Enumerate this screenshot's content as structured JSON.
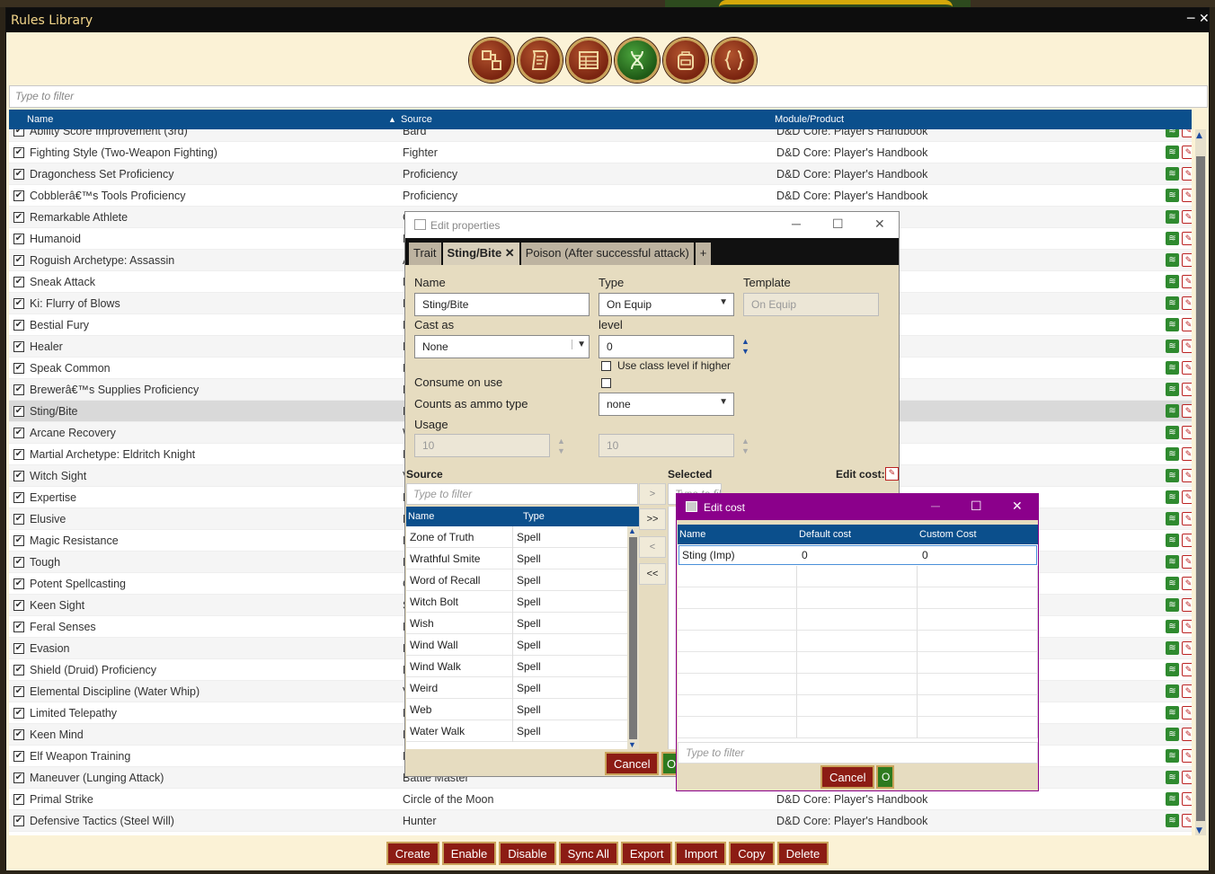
{
  "window": {
    "title": "Rules Library",
    "min_glyph": "─",
    "close_glyph": "✕"
  },
  "toolbar": {
    "icons": [
      "rules-icon",
      "scroll-icon",
      "table-icon",
      "dna-icon",
      "backpack-icon",
      "braces-icon"
    ]
  },
  "filter": {
    "placeholder": "Type to filter"
  },
  "table": {
    "headers": {
      "name": "Name",
      "source": "Source",
      "module": "Module/Product"
    },
    "rows": [
      {
        "name": "Ability Score Improvement (3rd)",
        "source": "Bard",
        "module": "D&D Core: Player's Handbook"
      },
      {
        "name": "Fighting Style (Two-Weapon Fighting)",
        "source": "Fighter",
        "module": "D&D Core: Player's Handbook"
      },
      {
        "name": "Dragonchess Set Proficiency",
        "source": "Proficiency",
        "module": "D&D Core: Player's Handbook"
      },
      {
        "name": "Cobblerâ€™s Tools Proficiency",
        "source": "Proficiency",
        "module": "D&D Core: Player's Handbook"
      },
      {
        "name": "Remarkable Athlete",
        "source": "C",
        "module": "ook"
      },
      {
        "name": "Humanoid",
        "source": "D",
        "module": "ook"
      },
      {
        "name": "Roguish Archetype: Assassin",
        "source": "A",
        "module": "ook"
      },
      {
        "name": "Sneak Attack",
        "source": "R",
        "module": "ook"
      },
      {
        "name": "Ki: Flurry of Blows",
        "source": "M",
        "module": "ook"
      },
      {
        "name": "Bestial Fury",
        "source": "B",
        "module": "ook"
      },
      {
        "name": "Healer",
        "source": "F",
        "module": "ook"
      },
      {
        "name": "Speak Common",
        "source": "H",
        "module": "ook"
      },
      {
        "name": "Brewerâ€™s Supplies Proficiency",
        "source": "P",
        "module": "ook"
      },
      {
        "name": "Sting/Bite",
        "source": "D",
        "module": "al"
      },
      {
        "name": "Arcane Recovery",
        "source": "W",
        "module": "ook"
      },
      {
        "name": "Martial Archetype: Eldritch Knight",
        "source": "E",
        "module": "ook"
      },
      {
        "name": "Witch Sight",
        "source": "V",
        "module": "ook"
      },
      {
        "name": "Expertise",
        "source": "E",
        "module": ""
      },
      {
        "name": "Elusive",
        "source": "E",
        "module": ""
      },
      {
        "name": "Magic Resistance",
        "source": "D",
        "module": ""
      },
      {
        "name": "Tough",
        "source": "F",
        "module": ""
      },
      {
        "name": "Potent Spellcasting",
        "source": "C",
        "module": ""
      },
      {
        "name": "Keen Sight",
        "source": "S",
        "module": ""
      },
      {
        "name": "Feral Senses",
        "source": "F",
        "module": ""
      },
      {
        "name": "Evasion",
        "source": "E",
        "module": ""
      },
      {
        "name": "Shield (Druid) Proficiency",
        "source": "D",
        "module": ""
      },
      {
        "name": "Elemental Discipline (Water Whip)",
        "source": "V",
        "module": ""
      },
      {
        "name": "Limited Telepathy",
        "source": "F",
        "module": ""
      },
      {
        "name": "Keen Mind",
        "source": "F",
        "module": ""
      },
      {
        "name": "Elf Weapon Training",
        "source": "H",
        "module": ""
      },
      {
        "name": "Maneuver (Lunging Attack)",
        "source": "Battle Master",
        "module": ""
      },
      {
        "name": "Primal Strike",
        "source": "Circle of the Moon",
        "module": "D&D Core: Player's Handbook"
      },
      {
        "name": "Defensive Tactics (Steel Will)",
        "source": "Hunter",
        "module": "D&D Core: Player's Handbook"
      }
    ]
  },
  "buttons": {
    "create": "Create",
    "enable": "Enable",
    "disable": "Disable",
    "sync_all": "Sync All",
    "export": "Export",
    "import": "Import",
    "copy": "Copy",
    "delete": "Delete"
  },
  "edit": {
    "title": "Edit properties",
    "tabs": [
      "Trait",
      "Sting/Bite ✕",
      "Poison (After successful attack)",
      "+"
    ],
    "name_label": "Name",
    "name_value": "Sting/Bite",
    "type_label": "Type",
    "type_value": "On Equip",
    "template_label": "Template",
    "template_value": "On Equip",
    "cast_label": "Cast as",
    "cast_value": "None",
    "level_label": "level",
    "level_value": "0",
    "use_class_level": "Use class level if higher",
    "consume_label": "Consume on use",
    "ammo_label": "Counts as ammo type",
    "ammo_value": "none",
    "usage_label": "Usage",
    "usage1": "10",
    "usage2": "10",
    "source_label": "Source",
    "selected_label": "Selected",
    "edit_cost_label": "Edit cost:",
    "filter_placeholder": "Type to filter",
    "list_headers": {
      "name": "Name",
      "type": "Type"
    },
    "list": [
      {
        "name": "Zone of Truth",
        "type": "Spell"
      },
      {
        "name": "Wrathful Smite",
        "type": "Spell"
      },
      {
        "name": "Word of Recall",
        "type": "Spell"
      },
      {
        "name": "Witch Bolt",
        "type": "Spell"
      },
      {
        "name": "Wish",
        "type": "Spell"
      },
      {
        "name": "Wind Wall",
        "type": "Spell"
      },
      {
        "name": "Wind Walk",
        "type": "Spell"
      },
      {
        "name": "Weird",
        "type": "Spell"
      },
      {
        "name": "Web",
        "type": "Spell"
      },
      {
        "name": "Water Walk",
        "type": "Spell"
      }
    ],
    "move": {
      "add": ">",
      "add_all": ">>",
      "remove": "<",
      "remove_all": "<<"
    },
    "cancel": "Cancel",
    "ok": "O"
  },
  "cost": {
    "title": "Edit cost",
    "headers": {
      "name": "Name",
      "default": "Default cost",
      "custom": "Custom Cost"
    },
    "row": {
      "name": "Sting (Imp)",
      "default": "0",
      "custom": "0"
    },
    "filter_placeholder": "Type to filter",
    "cancel": "Cancel",
    "ok": "O"
  }
}
